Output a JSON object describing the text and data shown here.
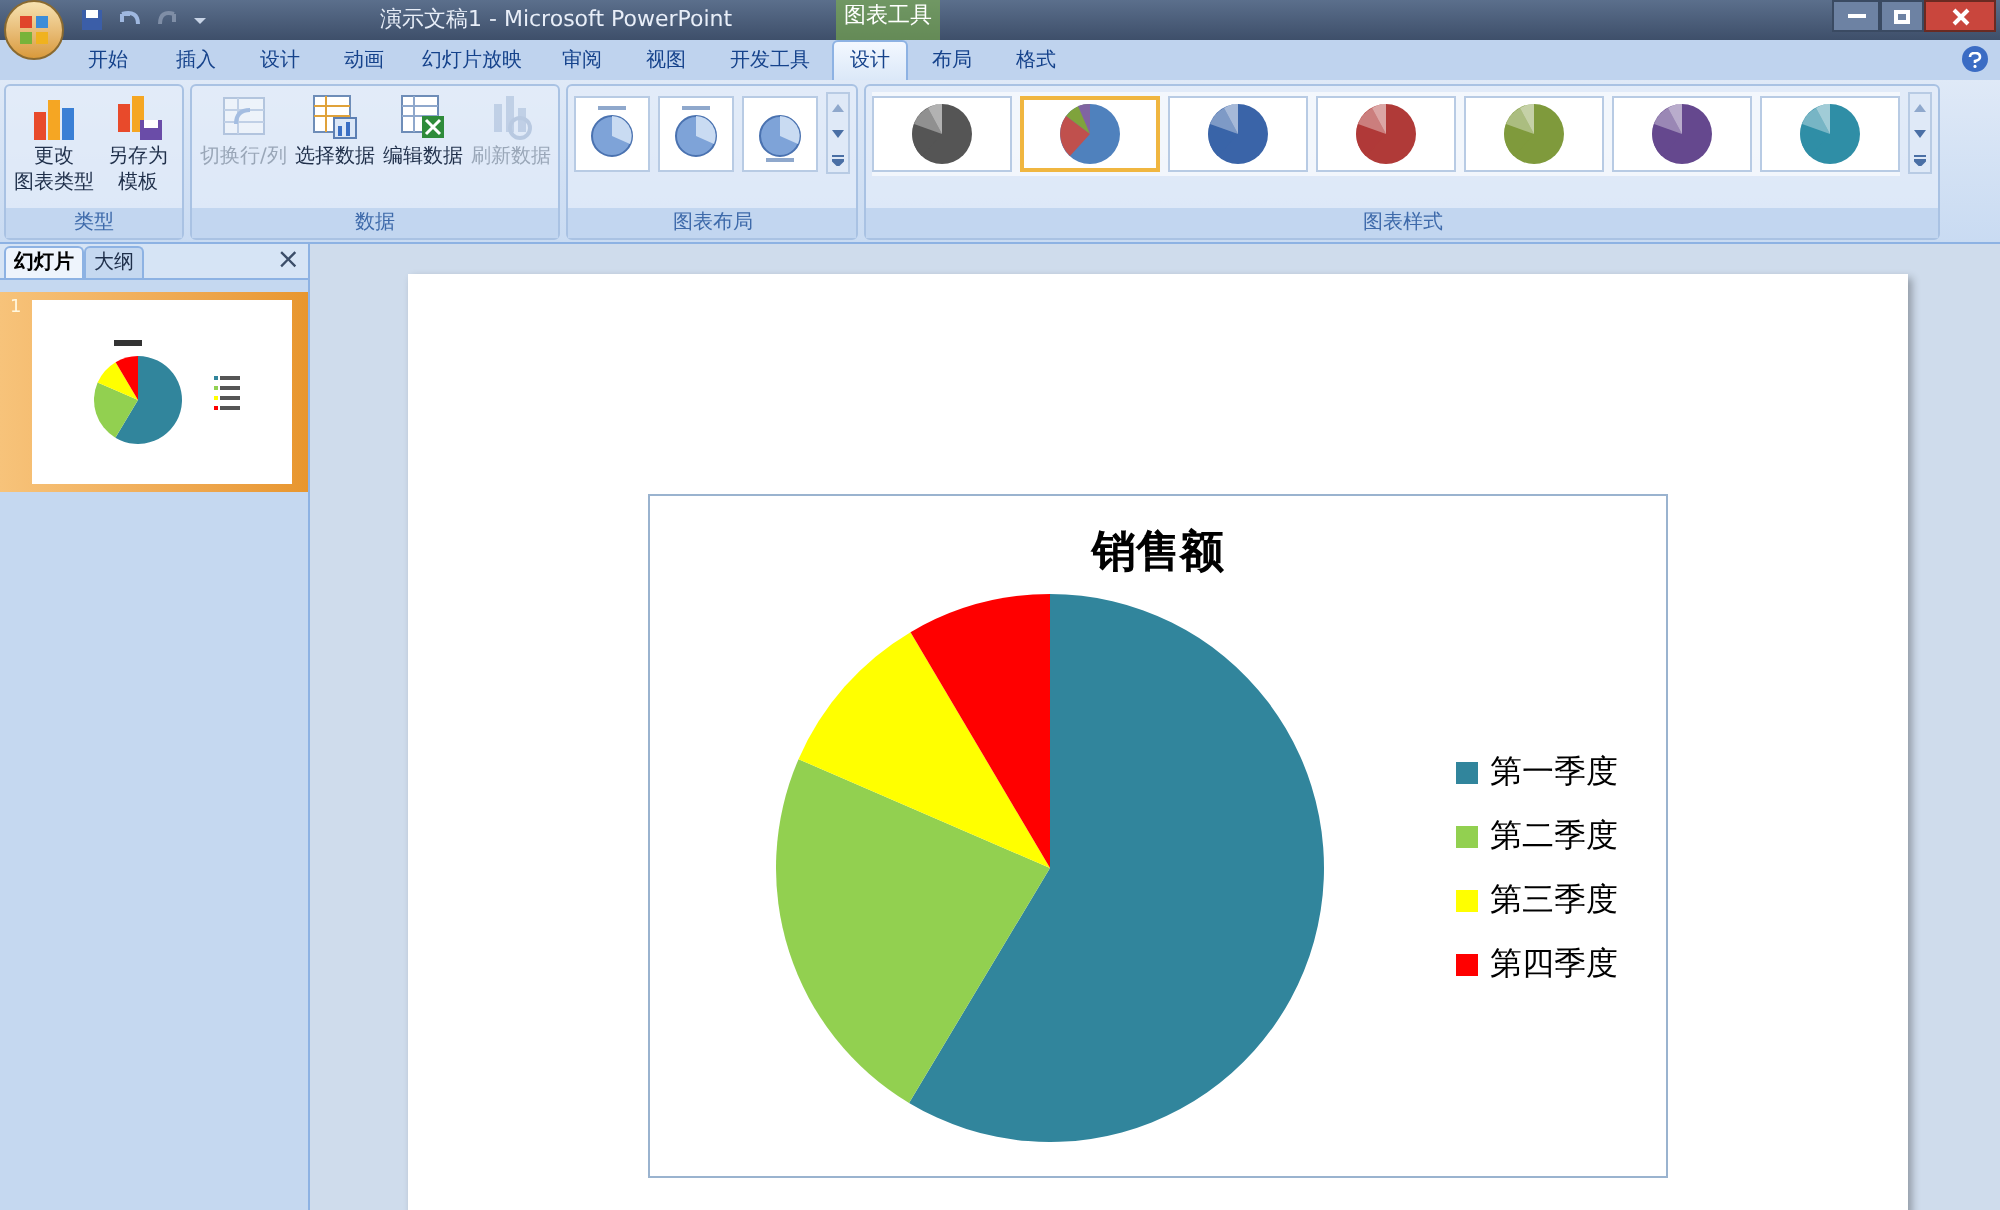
{
  "window": {
    "title": "演示文稿1 - Microsoft PowerPoint",
    "context_tab": "图表工具"
  },
  "tabs": [
    {
      "label": "开始",
      "selected": false
    },
    {
      "label": "插入",
      "selected": false
    },
    {
      "label": "设计",
      "selected": false
    },
    {
      "label": "动画",
      "selected": false
    },
    {
      "label": "幻灯片放映",
      "selected": false
    },
    {
      "label": "审阅",
      "selected": false
    },
    {
      "label": "视图",
      "selected": false
    },
    {
      "label": "开发工具",
      "selected": false
    },
    {
      "label": "设计",
      "selected": true
    },
    {
      "label": "布局",
      "selected": false
    },
    {
      "label": "格式",
      "selected": false
    }
  ],
  "ribbon": {
    "groups": [
      {
        "kind": "buttons",
        "label": "类型",
        "buttons": [
          {
            "label": [
              "更改",
              "图表类型"
            ],
            "kind": "chart",
            "disabled": false
          },
          {
            "label": [
              "另存为",
              "模板"
            ],
            "kind": "save",
            "disabled": false
          }
        ]
      },
      {
        "kind": "buttons",
        "label": "数据",
        "buttons": [
          {
            "label": [
              "切换行/列"
            ],
            "kind": "switch",
            "disabled": true
          },
          {
            "label": [
              "选择数据"
            ],
            "kind": "table",
            "disabled": false
          },
          {
            "label": [
              "编辑数据"
            ],
            "kind": "excel",
            "disabled": false
          },
          {
            "label": [
              "刷新数据"
            ],
            "kind": "refresh",
            "disabled": true
          }
        ]
      },
      {
        "kind": "layouts",
        "label": "图表布局",
        "items": [
          {
            "selected": false
          },
          {
            "selected": false
          },
          {
            "selected": false
          }
        ]
      },
      {
        "kind": "styles",
        "label": "图表样式",
        "items": [
          {
            "selected": false,
            "color": "#555555"
          },
          {
            "selected": true,
            "color": "#4f81bd"
          },
          {
            "selected": false,
            "color": "#3a64a8"
          },
          {
            "selected": false,
            "color": "#b03a38"
          },
          {
            "selected": false,
            "color": "#7f9a3c"
          },
          {
            "selected": false,
            "color": "#65488e"
          },
          {
            "selected": false,
            "color": "#2f8ea6"
          }
        ]
      }
    ]
  },
  "slides_panel": {
    "tabs": [
      {
        "label": "幻灯片",
        "selected": true
      },
      {
        "label": "大纲",
        "selected": false
      }
    ],
    "close": "×",
    "slides": [
      {
        "number": "1",
        "selected": true
      }
    ]
  },
  "chart": {
    "title": "销售额",
    "legend": [
      {
        "label": "第一季度",
        "color": "#31859c"
      },
      {
        "label": "第二季度",
        "color": "#92d050"
      },
      {
        "label": "第三季度",
        "color": "#ffff00"
      },
      {
        "label": "第四季度",
        "color": "#ff0000"
      }
    ]
  }
}
